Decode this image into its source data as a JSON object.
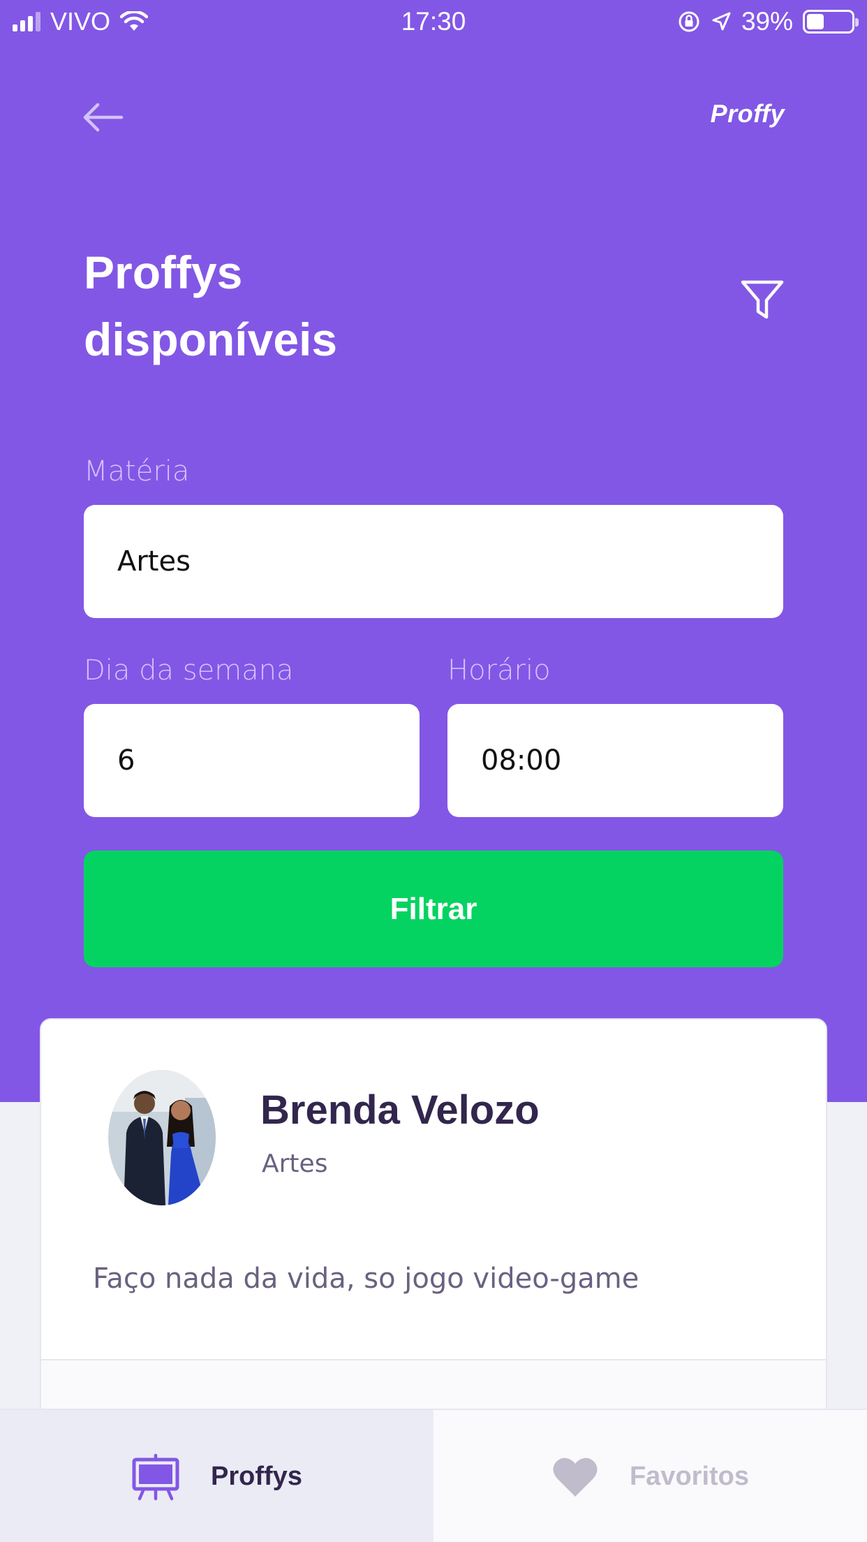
{
  "status_bar": {
    "carrier": "VIVO",
    "time": "17:30",
    "battery_percent_label": "39%",
    "battery_level": 0.39
  },
  "header": {
    "logo": "Proffy",
    "title_line1": "Proffys",
    "title_line2": "disponíveis"
  },
  "filters": {
    "subject_label": "Matéria",
    "subject_value": "Artes",
    "weekday_label": "Dia da semana",
    "weekday_value": "6",
    "time_label": "Horário",
    "time_value": "08:00",
    "submit_label": "Filtrar"
  },
  "teacher_card": {
    "name": "Brenda Velozo",
    "subject": "Artes",
    "bio": "Faço nada da vida, so jogo video-game"
  },
  "tabs": [
    {
      "label": "Proffys",
      "icon": "easel-icon",
      "active": true
    },
    {
      "label": "Favoritos",
      "icon": "heart-icon",
      "active": false
    }
  ],
  "colors": {
    "primary": "#8257E5",
    "secondary": "#04D361",
    "title_dark": "#32264D",
    "text_muted": "#6A6180"
  }
}
